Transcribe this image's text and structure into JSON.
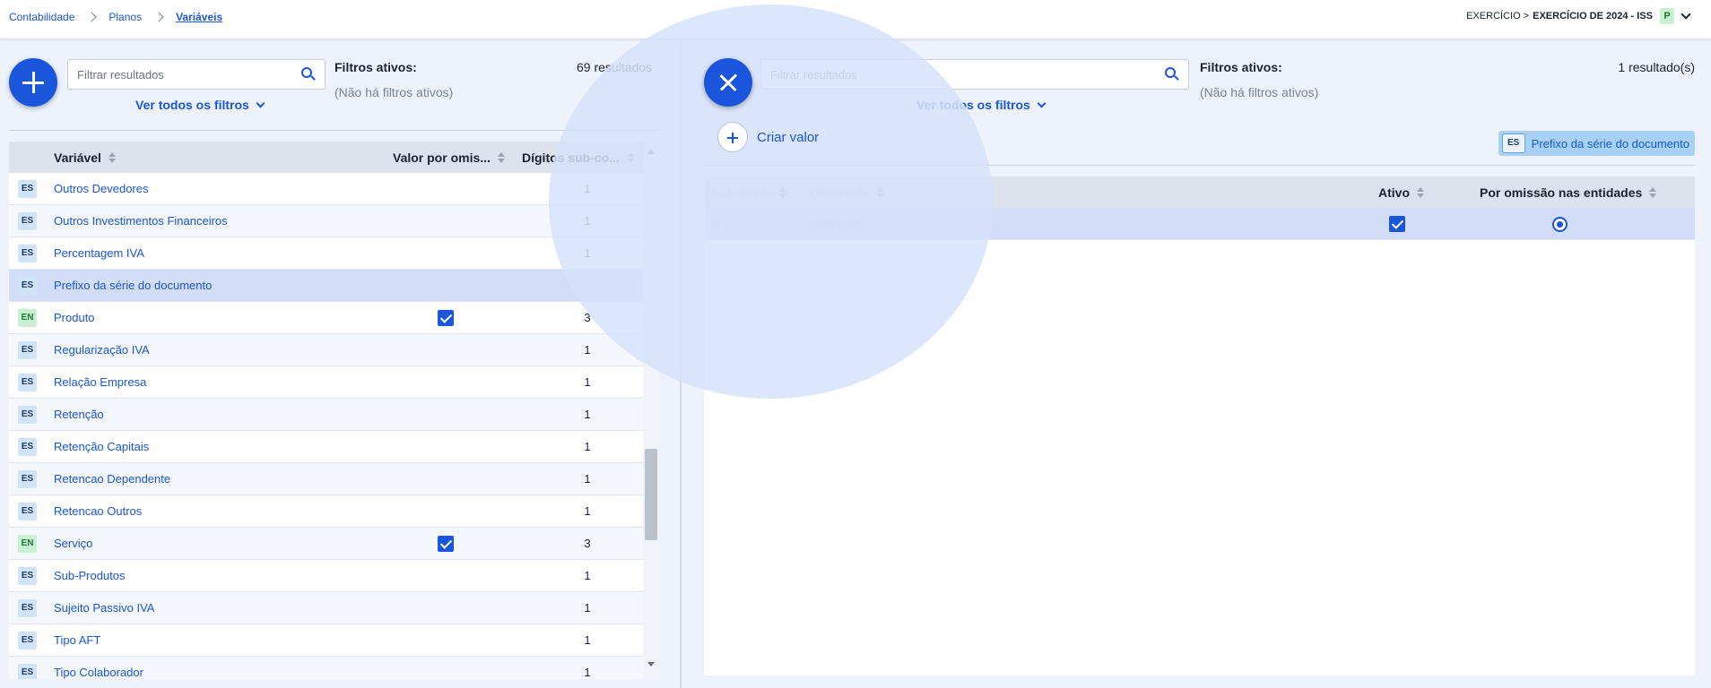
{
  "breadcrumb": [
    {
      "label": "Contabilidade"
    },
    {
      "label": "Planos"
    },
    {
      "label": "Variáveis"
    }
  ],
  "exercise": {
    "prefix": "EXERCÍCIO >",
    "name": "EXERCÍCIO DE 2024 - ISS",
    "badge": "P"
  },
  "left": {
    "search_placeholder": "Filtrar resultados",
    "filters_link": "Ver todos os filtros",
    "active_filters_title": "Filtros ativos:",
    "active_filters_none": "(Não há filtros ativos)",
    "result_count": "69 resultados",
    "columns": {
      "variable": "Variável",
      "default_value": "Valor por omis...",
      "digits": "Dígitos sub-co..."
    },
    "rows": [
      {
        "type": "ES",
        "name": "Outros Devedores",
        "checked": false,
        "digits": "1"
      },
      {
        "type": "ES",
        "name": "Outros Investimentos Financeiros",
        "checked": false,
        "digits": "1"
      },
      {
        "type": "ES",
        "name": "Percentagem IVA",
        "checked": false,
        "digits": "1"
      },
      {
        "type": "ES",
        "name": "Prefixo da série do documento",
        "checked": false,
        "digits": "",
        "selected": true
      },
      {
        "type": "EN",
        "name": "Produto",
        "checked": true,
        "digits": "3"
      },
      {
        "type": "ES",
        "name": "Regularização IVA",
        "checked": false,
        "digits": "1"
      },
      {
        "type": "ES",
        "name": "Relação Empresa",
        "checked": false,
        "digits": "1"
      },
      {
        "type": "ES",
        "name": "Retenção",
        "checked": false,
        "digits": "1"
      },
      {
        "type": "ES",
        "name": "Retenção Capitais",
        "checked": false,
        "digits": "1"
      },
      {
        "type": "ES",
        "name": "Retencao Dependente",
        "checked": false,
        "digits": "1"
      },
      {
        "type": "ES",
        "name": "Retencao Outros",
        "checked": false,
        "digits": "1"
      },
      {
        "type": "EN",
        "name": "Serviço",
        "checked": true,
        "digits": "3"
      },
      {
        "type": "ES",
        "name": "Sub-Produtos",
        "checked": false,
        "digits": "1"
      },
      {
        "type": "ES",
        "name": "Sujeito Passivo IVA",
        "checked": false,
        "digits": "1"
      },
      {
        "type": "ES",
        "name": "Tipo AFT",
        "checked": false,
        "digits": "1"
      },
      {
        "type": "ES",
        "name": "Tipo Colaborador",
        "checked": false,
        "digits": "1"
      }
    ]
  },
  "right": {
    "search_placeholder": "Filtrar resultados",
    "filters_link": "Ver todos os filtros",
    "active_filters_title": "Filtros ativos:",
    "active_filters_none": "(Não há filtros ativos)",
    "result_count": "1 resultado(s)",
    "create_value": "Criar valor",
    "chip": {
      "badge": "ES",
      "label": "Prefixo da série do documento"
    },
    "columns": {
      "subaccount": "Sub-conta",
      "description": "Descrição",
      "active": "Ativo",
      "default_entities": "Por omissão nas entidades"
    },
    "rows": [
      {
        "subaccount": "0",
        "description": "Sem série",
        "active": true,
        "default": true
      }
    ]
  },
  "colors": {
    "accent": "#1a56db",
    "selected_row": "#d2ddf7",
    "badge_es": "#cfe4f7",
    "badge_en": "#c9f0d3"
  }
}
